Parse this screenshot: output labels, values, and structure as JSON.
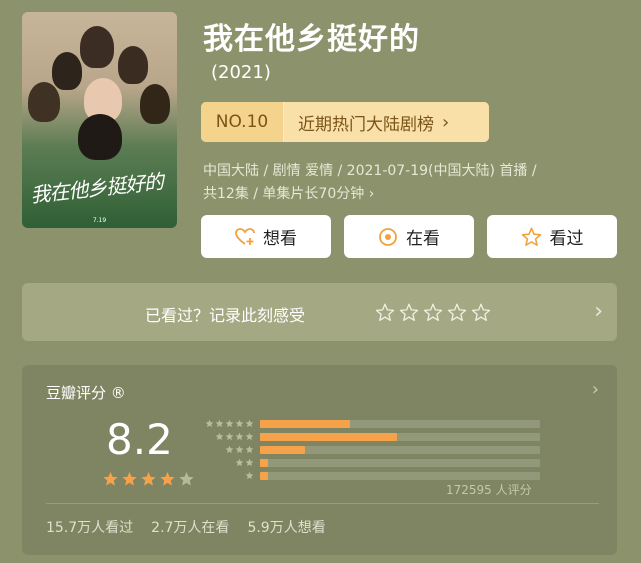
{
  "movie": {
    "title": "我在他乡挺好的",
    "year": "(2021)",
    "poster_title": "我在他乡挺好的",
    "poster_date": "7.19"
  },
  "ranking": {
    "number": "NO.10",
    "list_name": "近期热门大陆剧榜",
    "chevron": "›"
  },
  "meta": {
    "line1": "中国大陆 / 剧情 爱情 / 2021-07-19(中国大陆) 首播 /",
    "line2": "共12集 / 单集片长70分钟 ›"
  },
  "actions": {
    "want": {
      "label": "想看",
      "icon": "heart-plus-icon"
    },
    "watching": {
      "label": "在看",
      "icon": "target-icon"
    },
    "watched": {
      "label": "看过",
      "icon": "star-outline-icon"
    }
  },
  "seen_prompt": {
    "text": "已看过？记录此刻感受",
    "stars": 5,
    "arrow": "›"
  },
  "rating": {
    "label": "豆瓣评分 ®",
    "arrow": "›",
    "score": "8.2",
    "stars_filled": 4,
    "stars_total": 5,
    "distribution": [
      {
        "stars": 5,
        "fraction": 0.32
      },
      {
        "stars": 4,
        "fraction": 0.49
      },
      {
        "stars": 3,
        "fraction": 0.16
      },
      {
        "stars": 2,
        "fraction": 0.03
      },
      {
        "stars": 1,
        "fraction": 0.03
      }
    ],
    "count_text": "172595 人评分",
    "stats": {
      "watched": "15.7万人看过",
      "watching": "2.7万人在看",
      "want": "5.9万人想看"
    }
  },
  "colors": {
    "background": "#8c926b",
    "accent_orange": "#f6a24a",
    "rank_bg": "#f9dfa8",
    "rank_text": "#7b5518"
  }
}
